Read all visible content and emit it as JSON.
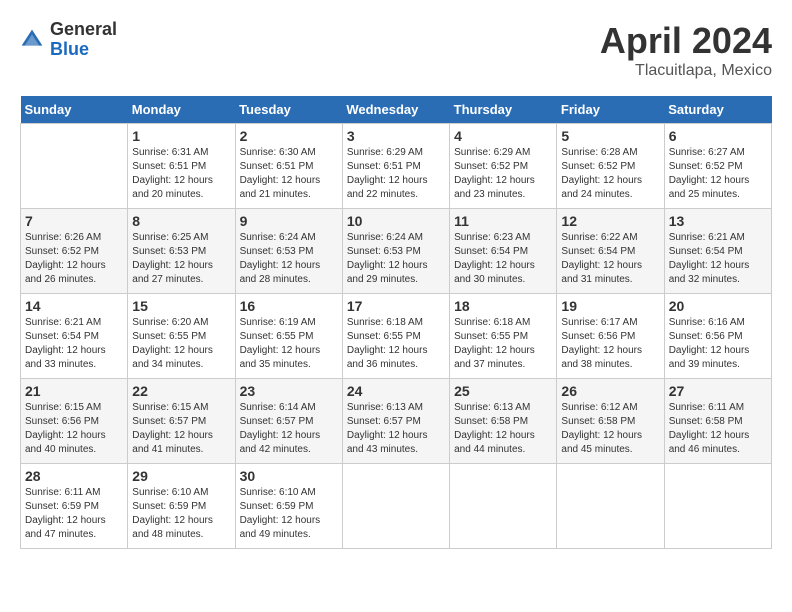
{
  "header": {
    "logo_general": "General",
    "logo_blue": "Blue",
    "title": "April 2024",
    "subtitle": "Tlacuitlapa, Mexico"
  },
  "columns": [
    "Sunday",
    "Monday",
    "Tuesday",
    "Wednesday",
    "Thursday",
    "Friday",
    "Saturday"
  ],
  "weeks": [
    [
      {
        "day": "",
        "sunrise": "",
        "sunset": "",
        "daylight": ""
      },
      {
        "day": "1",
        "sunrise": "Sunrise: 6:31 AM",
        "sunset": "Sunset: 6:51 PM",
        "daylight": "Daylight: 12 hours and 20 minutes."
      },
      {
        "day": "2",
        "sunrise": "Sunrise: 6:30 AM",
        "sunset": "Sunset: 6:51 PM",
        "daylight": "Daylight: 12 hours and 21 minutes."
      },
      {
        "day": "3",
        "sunrise": "Sunrise: 6:29 AM",
        "sunset": "Sunset: 6:51 PM",
        "daylight": "Daylight: 12 hours and 22 minutes."
      },
      {
        "day": "4",
        "sunrise": "Sunrise: 6:29 AM",
        "sunset": "Sunset: 6:52 PM",
        "daylight": "Daylight: 12 hours and 23 minutes."
      },
      {
        "day": "5",
        "sunrise": "Sunrise: 6:28 AM",
        "sunset": "Sunset: 6:52 PM",
        "daylight": "Daylight: 12 hours and 24 minutes."
      },
      {
        "day": "6",
        "sunrise": "Sunrise: 6:27 AM",
        "sunset": "Sunset: 6:52 PM",
        "daylight": "Daylight: 12 hours and 25 minutes."
      }
    ],
    [
      {
        "day": "7",
        "sunrise": "Sunrise: 6:26 AM",
        "sunset": "Sunset: 6:52 PM",
        "daylight": "Daylight: 12 hours and 26 minutes."
      },
      {
        "day": "8",
        "sunrise": "Sunrise: 6:25 AM",
        "sunset": "Sunset: 6:53 PM",
        "daylight": "Daylight: 12 hours and 27 minutes."
      },
      {
        "day": "9",
        "sunrise": "Sunrise: 6:24 AM",
        "sunset": "Sunset: 6:53 PM",
        "daylight": "Daylight: 12 hours and 28 minutes."
      },
      {
        "day": "10",
        "sunrise": "Sunrise: 6:24 AM",
        "sunset": "Sunset: 6:53 PM",
        "daylight": "Daylight: 12 hours and 29 minutes."
      },
      {
        "day": "11",
        "sunrise": "Sunrise: 6:23 AM",
        "sunset": "Sunset: 6:54 PM",
        "daylight": "Daylight: 12 hours and 30 minutes."
      },
      {
        "day": "12",
        "sunrise": "Sunrise: 6:22 AM",
        "sunset": "Sunset: 6:54 PM",
        "daylight": "Daylight: 12 hours and 31 minutes."
      },
      {
        "day": "13",
        "sunrise": "Sunrise: 6:21 AM",
        "sunset": "Sunset: 6:54 PM",
        "daylight": "Daylight: 12 hours and 32 minutes."
      }
    ],
    [
      {
        "day": "14",
        "sunrise": "Sunrise: 6:21 AM",
        "sunset": "Sunset: 6:54 PM",
        "daylight": "Daylight: 12 hours and 33 minutes."
      },
      {
        "day": "15",
        "sunrise": "Sunrise: 6:20 AM",
        "sunset": "Sunset: 6:55 PM",
        "daylight": "Daylight: 12 hours and 34 minutes."
      },
      {
        "day": "16",
        "sunrise": "Sunrise: 6:19 AM",
        "sunset": "Sunset: 6:55 PM",
        "daylight": "Daylight: 12 hours and 35 minutes."
      },
      {
        "day": "17",
        "sunrise": "Sunrise: 6:18 AM",
        "sunset": "Sunset: 6:55 PM",
        "daylight": "Daylight: 12 hours and 36 minutes."
      },
      {
        "day": "18",
        "sunrise": "Sunrise: 6:18 AM",
        "sunset": "Sunset: 6:55 PM",
        "daylight": "Daylight: 12 hours and 37 minutes."
      },
      {
        "day": "19",
        "sunrise": "Sunrise: 6:17 AM",
        "sunset": "Sunset: 6:56 PM",
        "daylight": "Daylight: 12 hours and 38 minutes."
      },
      {
        "day": "20",
        "sunrise": "Sunrise: 6:16 AM",
        "sunset": "Sunset: 6:56 PM",
        "daylight": "Daylight: 12 hours and 39 minutes."
      }
    ],
    [
      {
        "day": "21",
        "sunrise": "Sunrise: 6:15 AM",
        "sunset": "Sunset: 6:56 PM",
        "daylight": "Daylight: 12 hours and 40 minutes."
      },
      {
        "day": "22",
        "sunrise": "Sunrise: 6:15 AM",
        "sunset": "Sunset: 6:57 PM",
        "daylight": "Daylight: 12 hours and 41 minutes."
      },
      {
        "day": "23",
        "sunrise": "Sunrise: 6:14 AM",
        "sunset": "Sunset: 6:57 PM",
        "daylight": "Daylight: 12 hours and 42 minutes."
      },
      {
        "day": "24",
        "sunrise": "Sunrise: 6:13 AM",
        "sunset": "Sunset: 6:57 PM",
        "daylight": "Daylight: 12 hours and 43 minutes."
      },
      {
        "day": "25",
        "sunrise": "Sunrise: 6:13 AM",
        "sunset": "Sunset: 6:58 PM",
        "daylight": "Daylight: 12 hours and 44 minutes."
      },
      {
        "day": "26",
        "sunrise": "Sunrise: 6:12 AM",
        "sunset": "Sunset: 6:58 PM",
        "daylight": "Daylight: 12 hours and 45 minutes."
      },
      {
        "day": "27",
        "sunrise": "Sunrise: 6:11 AM",
        "sunset": "Sunset: 6:58 PM",
        "daylight": "Daylight: 12 hours and 46 minutes."
      }
    ],
    [
      {
        "day": "28",
        "sunrise": "Sunrise: 6:11 AM",
        "sunset": "Sunset: 6:59 PM",
        "daylight": "Daylight: 12 hours and 47 minutes."
      },
      {
        "day": "29",
        "sunrise": "Sunrise: 6:10 AM",
        "sunset": "Sunset: 6:59 PM",
        "daylight": "Daylight: 12 hours and 48 minutes."
      },
      {
        "day": "30",
        "sunrise": "Sunrise: 6:10 AM",
        "sunset": "Sunset: 6:59 PM",
        "daylight": "Daylight: 12 hours and 49 minutes."
      },
      {
        "day": "",
        "sunrise": "",
        "sunset": "",
        "daylight": ""
      },
      {
        "day": "",
        "sunrise": "",
        "sunset": "",
        "daylight": ""
      },
      {
        "day": "",
        "sunrise": "",
        "sunset": "",
        "daylight": ""
      },
      {
        "day": "",
        "sunrise": "",
        "sunset": "",
        "daylight": ""
      }
    ]
  ]
}
